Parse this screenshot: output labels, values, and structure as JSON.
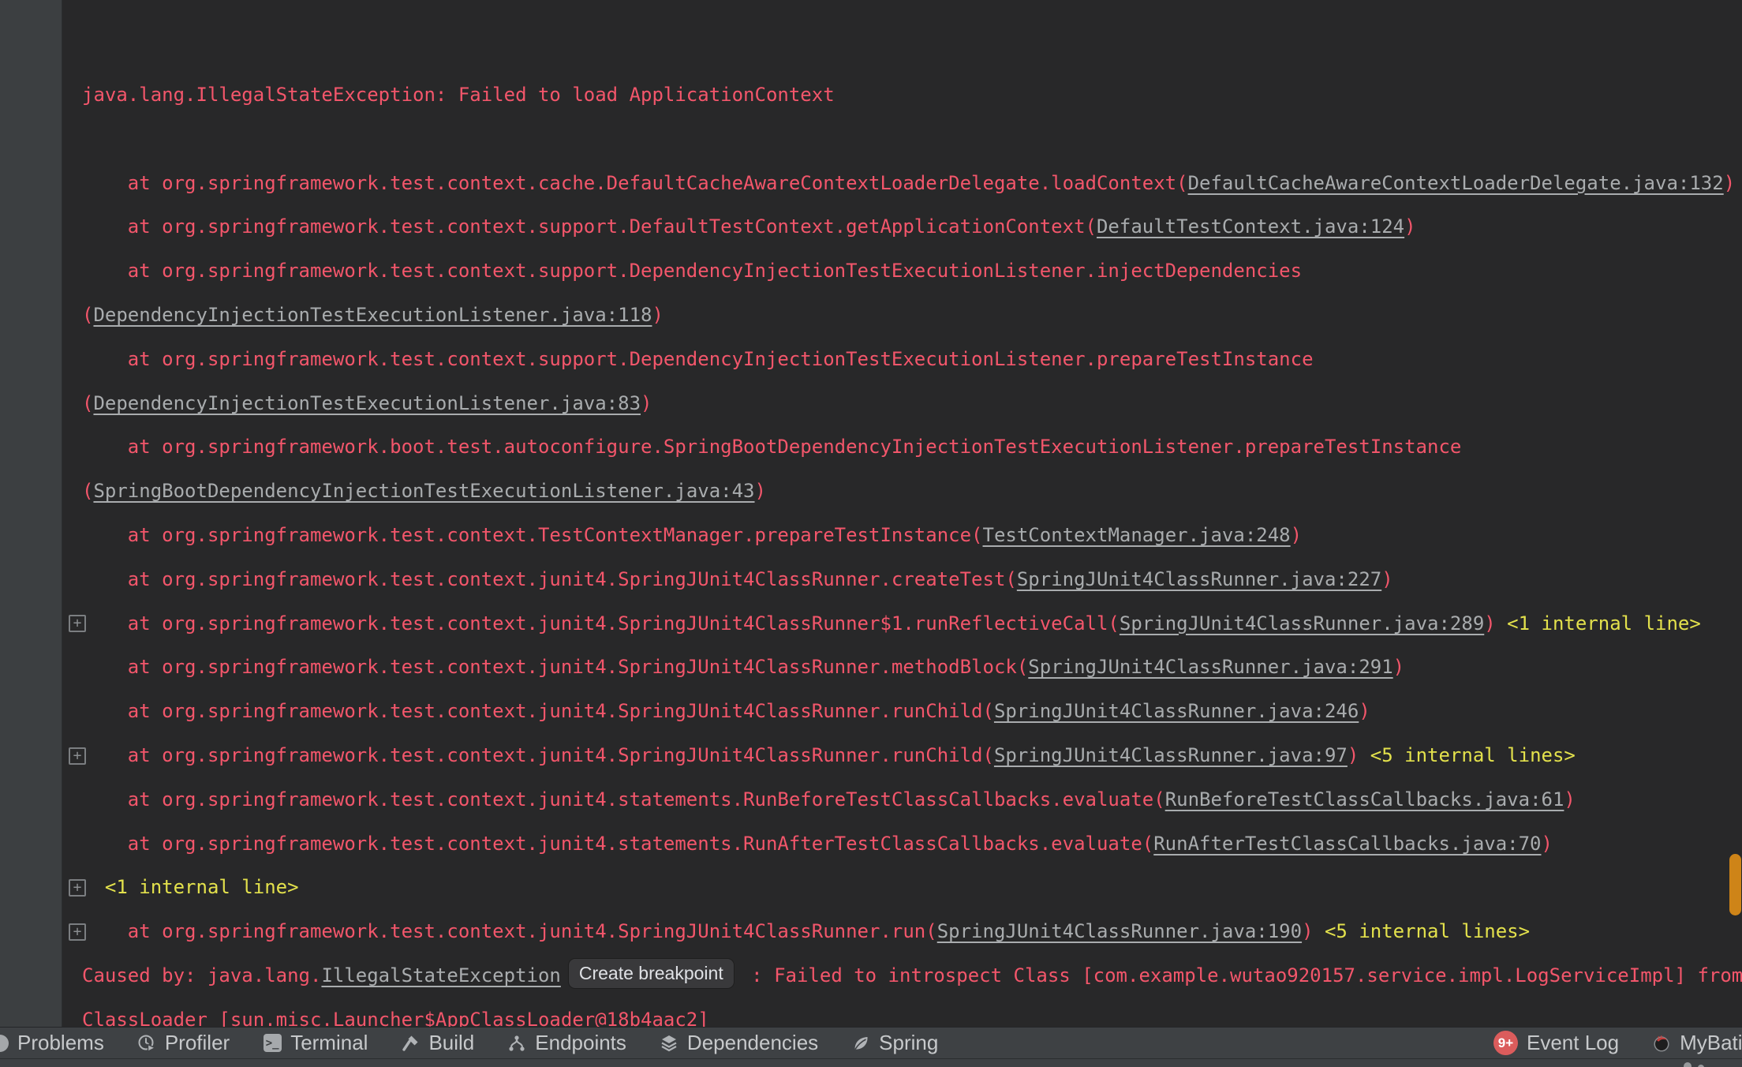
{
  "colors": {
    "console_bg": "#282829",
    "gutter_bg": "#3C3F41",
    "error_red": "#F3566B",
    "link_gray": "#A9ACAE",
    "fold_yellow": "#E3E14C",
    "scrollbar_orange": "#CE8418",
    "toolbar_bg": "#3E4144",
    "badge_red": "#DB5C5C"
  },
  "console": {
    "lines": [
      {
        "fold": false,
        "segments": [
          {
            "style": "error",
            "text": "java.lang.IllegalStateException: Failed to load ApplicationContext"
          }
        ]
      },
      {
        "fold": false,
        "segments": []
      },
      {
        "fold": false,
        "segments": [
          {
            "style": "error",
            "text": "    at org.springframework.test.context.cache.DefaultCacheAwareContextLoaderDelegate.loadContext("
          },
          {
            "style": "link",
            "text": "DefaultCacheAwareContextLoaderDelegate.java:132"
          },
          {
            "style": "error",
            "text": ")"
          }
        ]
      },
      {
        "fold": false,
        "segments": [
          {
            "style": "error",
            "text": "    at org.springframework.test.context.support.DefaultTestContext.getApplicationContext("
          },
          {
            "style": "link",
            "text": "DefaultTestContext.java:124"
          },
          {
            "style": "error",
            "text": ")"
          }
        ]
      },
      {
        "fold": false,
        "segments": [
          {
            "style": "error",
            "text": "    at org.springframework.test.context.support.DependencyInjectionTestExecutionListener.injectDependencies"
          }
        ]
      },
      {
        "fold": false,
        "segments": [
          {
            "style": "error",
            "text": "("
          },
          {
            "style": "link",
            "text": "DependencyInjectionTestExecutionListener.java:118"
          },
          {
            "style": "error",
            "text": ")"
          }
        ]
      },
      {
        "fold": false,
        "segments": [
          {
            "style": "error",
            "text": "    at org.springframework.test.context.support.DependencyInjectionTestExecutionListener.prepareTestInstance"
          }
        ]
      },
      {
        "fold": false,
        "segments": [
          {
            "style": "error",
            "text": "("
          },
          {
            "style": "link",
            "text": "DependencyInjectionTestExecutionListener.java:83"
          },
          {
            "style": "error",
            "text": ")"
          }
        ]
      },
      {
        "fold": false,
        "segments": [
          {
            "style": "error",
            "text": "    at org.springframework.boot.test.autoconfigure.SpringBootDependencyInjectionTestExecutionListener.prepareTestInstance"
          }
        ]
      },
      {
        "fold": false,
        "segments": [
          {
            "style": "error",
            "text": "("
          },
          {
            "style": "link",
            "text": "SpringBootDependencyInjectionTestExecutionListener.java:43"
          },
          {
            "style": "error",
            "text": ")"
          }
        ]
      },
      {
        "fold": false,
        "segments": [
          {
            "style": "error",
            "text": "    at org.springframework.test.context.TestContextManager.prepareTestInstance("
          },
          {
            "style": "link",
            "text": "TestContextManager.java:248"
          },
          {
            "style": "error",
            "text": ")"
          }
        ]
      },
      {
        "fold": false,
        "segments": [
          {
            "style": "error",
            "text": "    at org.springframework.test.context.junit4.SpringJUnit4ClassRunner.createTest("
          },
          {
            "style": "link",
            "text": "SpringJUnit4ClassRunner.java:227"
          },
          {
            "style": "error",
            "text": ")"
          }
        ]
      },
      {
        "fold": true,
        "segments": [
          {
            "style": "error",
            "text": "    at org.springframework.test.context.junit4.SpringJUnit4ClassRunner$1.runReflectiveCall("
          },
          {
            "style": "link",
            "text": "SpringJUnit4ClassRunner.java:289"
          },
          {
            "style": "error",
            "text": ") "
          },
          {
            "style": "fold",
            "text": "<1 internal line>"
          }
        ]
      },
      {
        "fold": false,
        "segments": [
          {
            "style": "error",
            "text": "    at org.springframework.test.context.junit4.SpringJUnit4ClassRunner.methodBlock("
          },
          {
            "style": "link",
            "text": "SpringJUnit4ClassRunner.java:291"
          },
          {
            "style": "error",
            "text": ")"
          }
        ]
      },
      {
        "fold": false,
        "segments": [
          {
            "style": "error",
            "text": "    at org.springframework.test.context.junit4.SpringJUnit4ClassRunner.runChild("
          },
          {
            "style": "link",
            "text": "SpringJUnit4ClassRunner.java:246"
          },
          {
            "style": "error",
            "text": ")"
          }
        ]
      },
      {
        "fold": true,
        "segments": [
          {
            "style": "error",
            "text": "    at org.springframework.test.context.junit4.SpringJUnit4ClassRunner.runChild("
          },
          {
            "style": "link",
            "text": "SpringJUnit4ClassRunner.java:97"
          },
          {
            "style": "error",
            "text": ") "
          },
          {
            "style": "fold",
            "text": "<5 internal lines>"
          }
        ]
      },
      {
        "fold": false,
        "segments": [
          {
            "style": "error",
            "text": "    at org.springframework.test.context.junit4.statements.RunBeforeTestClassCallbacks.evaluate("
          },
          {
            "style": "link",
            "text": "RunBeforeTestClassCallbacks.java:61"
          },
          {
            "style": "error",
            "text": ")"
          }
        ]
      },
      {
        "fold": false,
        "segments": [
          {
            "style": "error",
            "text": "    at org.springframework.test.context.junit4.statements.RunAfterTestClassCallbacks.evaluate("
          },
          {
            "style": "link",
            "text": "RunAfterTestClassCallbacks.java:70"
          },
          {
            "style": "error",
            "text": ")"
          }
        ]
      },
      {
        "fold": true,
        "segments": [
          {
            "style": "fold",
            "text": "  <1 internal line>"
          }
        ]
      },
      {
        "fold": true,
        "segments": [
          {
            "style": "error",
            "text": "    at org.springframework.test.context.junit4.SpringJUnit4ClassRunner.run("
          },
          {
            "style": "link",
            "text": "SpringJUnit4ClassRunner.java:190"
          },
          {
            "style": "error",
            "text": ") "
          },
          {
            "style": "fold",
            "text": "<5 internal lines>"
          }
        ]
      },
      {
        "fold": false,
        "segments": [
          {
            "style": "error",
            "text": "Caused by: java.lang."
          },
          {
            "style": "link",
            "text": "IllegalStateException"
          },
          {
            "style": "button",
            "text": "Create breakpoint"
          },
          {
            "style": "error",
            "text": " : Failed to introspect Class [com.example.wutao920157.service.impl.LogServiceImpl] from"
          }
        ]
      },
      {
        "fold": false,
        "segments": [
          {
            "style": "error",
            "text": "ClassLoader [sun.misc.Launcher$AppClassLoader@18b4aac2]"
          }
        ]
      }
    ]
  },
  "toolbar": {
    "left": [
      {
        "key": "problems",
        "icon": "problems-icon",
        "label": "Problems"
      },
      {
        "key": "profiler",
        "icon": "profiler-icon",
        "label": "Profiler"
      },
      {
        "key": "terminal",
        "icon": "terminal-icon",
        "label": "Terminal"
      },
      {
        "key": "build",
        "icon": "build-hammer-icon",
        "label": "Build"
      },
      {
        "key": "endpoints",
        "icon": "endpoints-icon",
        "label": "Endpoints"
      },
      {
        "key": "dependencies",
        "icon": "dependencies-icon",
        "label": "Dependencies"
      },
      {
        "key": "spring",
        "icon": "spring-leaf-icon",
        "label": "Spring"
      }
    ],
    "right": [
      {
        "key": "event-log",
        "icon": "event-log-badge",
        "badge": "9+",
        "label": "Event Log"
      },
      {
        "key": "mybatis",
        "icon": "mybatis-bird-icon",
        "label": "MyBatis L"
      }
    ]
  }
}
